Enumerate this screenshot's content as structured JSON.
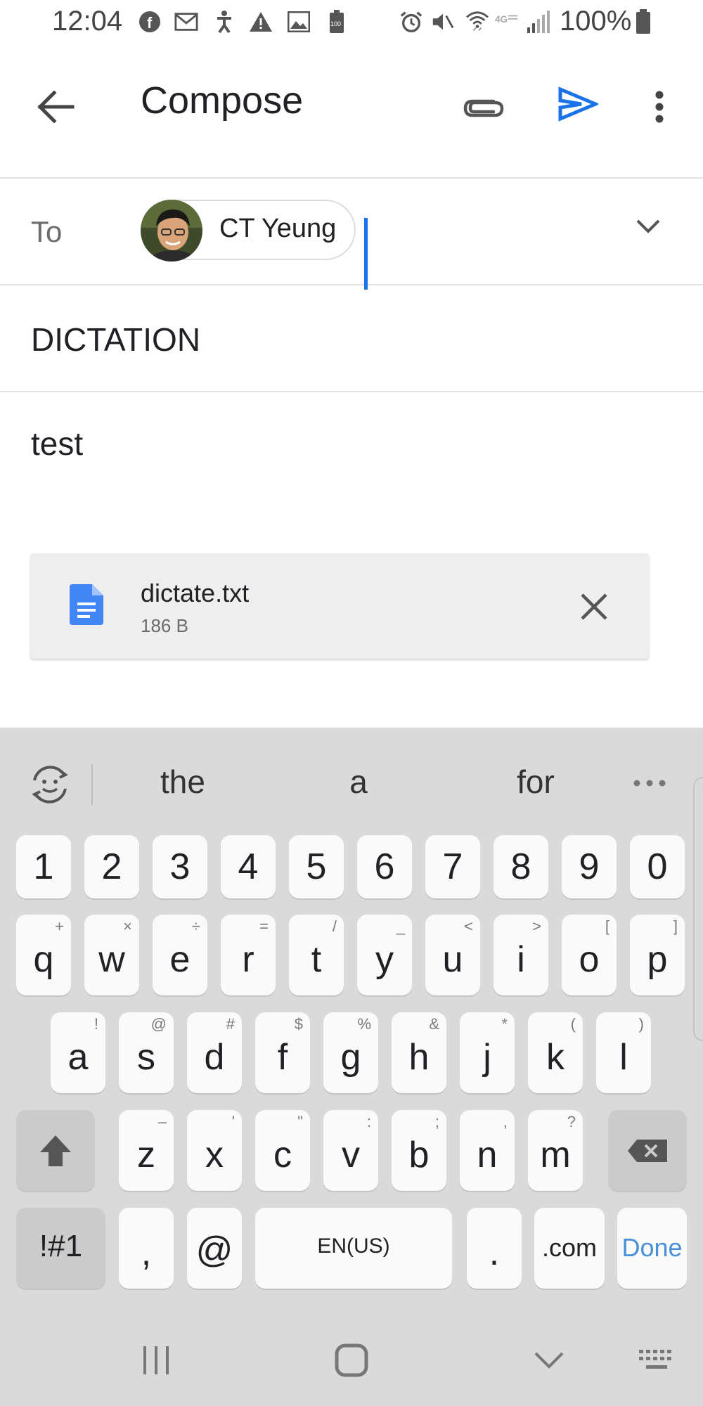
{
  "status_bar": {
    "time": "12:04",
    "battery": "100%",
    "icons": [
      "facebook-icon",
      "gmail-icon",
      "accessibility-icon",
      "alert-icon",
      "image-icon",
      "battery-saver-icon",
      "alarm-icon",
      "vibrate-icon",
      "wifi-icon",
      "4g-lte-icon",
      "signal-icon",
      "battery-icon"
    ]
  },
  "app_bar": {
    "title": "Compose",
    "back_icon": "arrow-back-icon",
    "attach_icon": "paperclip-icon",
    "send_icon": "send-icon",
    "more_icon": "more-vert-icon",
    "accent": "#1a73e8"
  },
  "to": {
    "label": "To",
    "recipient": "CT Yeung"
  },
  "subject": "DICTATION",
  "body": "test",
  "attachment": {
    "name": "dictate.txt",
    "size": "186 B",
    "icon": "document-icon",
    "icon_color": "#4285f4"
  },
  "keyboard": {
    "suggestions": [
      "the",
      "a",
      "for"
    ],
    "row_numbers": [
      "1",
      "2",
      "3",
      "4",
      "5",
      "6",
      "7",
      "8",
      "9",
      "0"
    ],
    "row_q": [
      {
        "k": "q",
        "s": "+"
      },
      {
        "k": "w",
        "s": "×"
      },
      {
        "k": "e",
        "s": "÷"
      },
      {
        "k": "r",
        "s": "="
      },
      {
        "k": "t",
        "s": "/"
      },
      {
        "k": "y",
        "s": "_"
      },
      {
        "k": "u",
        "s": "<"
      },
      {
        "k": "i",
        "s": ">"
      },
      {
        "k": "o",
        "s": "["
      },
      {
        "k": "p",
        "s": "]"
      }
    ],
    "row_a": [
      {
        "k": "a",
        "s": "!"
      },
      {
        "k": "s",
        "s": "@"
      },
      {
        "k": "d",
        "s": "#"
      },
      {
        "k": "f",
        "s": "$"
      },
      {
        "k": "g",
        "s": "%"
      },
      {
        "k": "h",
        "s": "&"
      },
      {
        "k": "j",
        "s": "*"
      },
      {
        "k": "k",
        "s": "("
      },
      {
        "k": "l",
        "s": ")"
      }
    ],
    "row_z": [
      {
        "k": "z",
        "s": "–"
      },
      {
        "k": "x",
        "s": "'"
      },
      {
        "k": "c",
        "s": "\""
      },
      {
        "k": "v",
        "s": ":"
      },
      {
        "k": "b",
        "s": ";"
      },
      {
        "k": "n",
        "s": ","
      },
      {
        "k": "m",
        "s": "?"
      }
    ],
    "symbols_label": "!#1",
    "comma_label": ",",
    "at_label": "@",
    "space_label": "EN(US)",
    "period_label": ".",
    "dotcom_label": ".com",
    "done_label": "Done",
    "done_color": "#4a90d9"
  },
  "nav_bar": {
    "recents_icon": "recents-icon",
    "home_icon": "home-icon",
    "hide_keyboard_icon": "chevron-down-icon",
    "keyboard_icon": "keyboard-icon"
  }
}
